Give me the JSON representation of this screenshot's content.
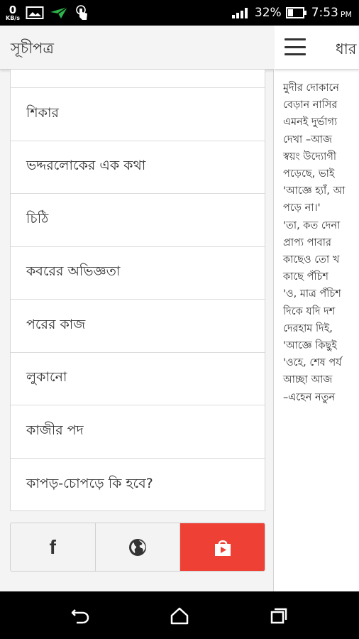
{
  "status_bar": {
    "net_speed": "0",
    "net_unit": "KB/s",
    "battery_percent": "32%",
    "time": "7:53",
    "ampm": "PM",
    "icons": [
      "image-icon",
      "send-icon",
      "touch-icon",
      "signal-icon",
      "battery-icon"
    ]
  },
  "drawer": {
    "title": "সূচীপত্র",
    "items": [
      "শিকার",
      "ভদ্দরলোকের এক কথা",
      "চিঠি",
      "কবরের অভিজ্ঞতা",
      "পরের কাজ",
      "লুকানো",
      "কাজীর পদ",
      "কাপড়-চোপড়ে কি হবে?"
    ],
    "share": {
      "facebook_label": "f",
      "icons": [
        "facebook-icon",
        "globe-icon",
        "shopping-bag-icon"
      ],
      "store_color": "#ee4035"
    }
  },
  "reader": {
    "title": "ধার",
    "lines": [
      "মুদীর দোকানে",
      "বেড়ান নাসির",
      "এমনই দুর্ভাগ্য",
      "দেখা –আজ",
      "স্বয়ং উদ্যোগী",
      "পড়েছে, ভাই",
      "'আজ্ঞে হ্যাঁ, আ",
      "পড়ে না।'",
      "'তা, কত দেনা",
      "প্রাপ্য পাবার",
      "কাছেও তো খ",
      "কাছে পঁচিশ",
      "'ও, মাত্র পঁচিশ",
      "দিকে যদি দশ",
      "দেরহাম দিই,",
      "'আজ্ঞে কিছুই",
      "'ওহে, শেষ পর্য",
      "আচ্ছা আজ",
      "–এহেন নতুন"
    ]
  },
  "nav": {
    "icons": [
      "back-icon",
      "home-icon",
      "recents-icon"
    ]
  }
}
